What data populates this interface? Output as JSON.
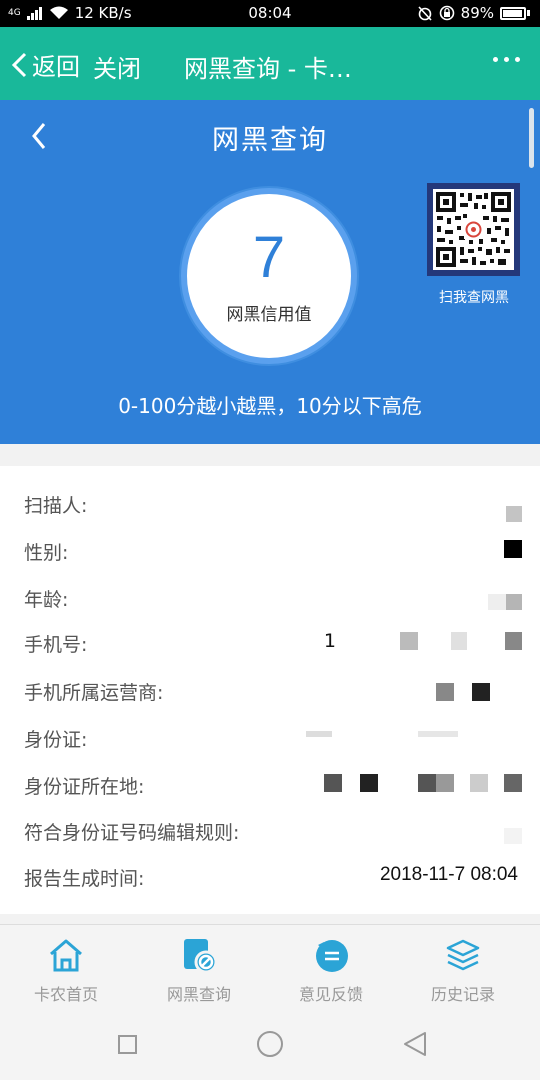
{
  "status_bar": {
    "network": "4G",
    "speed": "12 KB/s",
    "time": "08:04",
    "battery": "89%"
  },
  "titlebar": {
    "back_label": "返回",
    "close_label": "关闭",
    "title": "网黑查询 - 卡…"
  },
  "hero": {
    "title": "网黑查询",
    "score": "7",
    "score_label": "网黑信用值",
    "qr_caption": "扫我查网黑",
    "note": "0-100分越小越黑，10分以下高危"
  },
  "info": {
    "rows": [
      {
        "label": "扫描人:",
        "value": ""
      },
      {
        "label": "性别:",
        "value": ""
      },
      {
        "label": "年龄:",
        "value": ""
      },
      {
        "label": "手机号:",
        "value": "1"
      },
      {
        "label": "手机所属运营商:",
        "value": ""
      },
      {
        "label": "身份证:",
        "value": ""
      },
      {
        "label": "身份证所在地:",
        "value": ""
      },
      {
        "label": "符合身份证号码编辑规则:",
        "value": ""
      },
      {
        "label": "报告生成时间:",
        "value": "2018-11-7 08:04"
      }
    ]
  },
  "tabbar": {
    "tabs": [
      {
        "label": "卡农首页",
        "icon": "home-icon"
      },
      {
        "label": "网黑查询",
        "icon": "query-icon"
      },
      {
        "label": "意见反馈",
        "icon": "feedback-icon"
      },
      {
        "label": "历史记录",
        "icon": "layers-icon"
      }
    ]
  },
  "colors": {
    "titlebar": "#19b89a",
    "hero": "#2f80d8",
    "tab_active": "#2ba4d6",
    "tab_inactive": "#999999"
  }
}
